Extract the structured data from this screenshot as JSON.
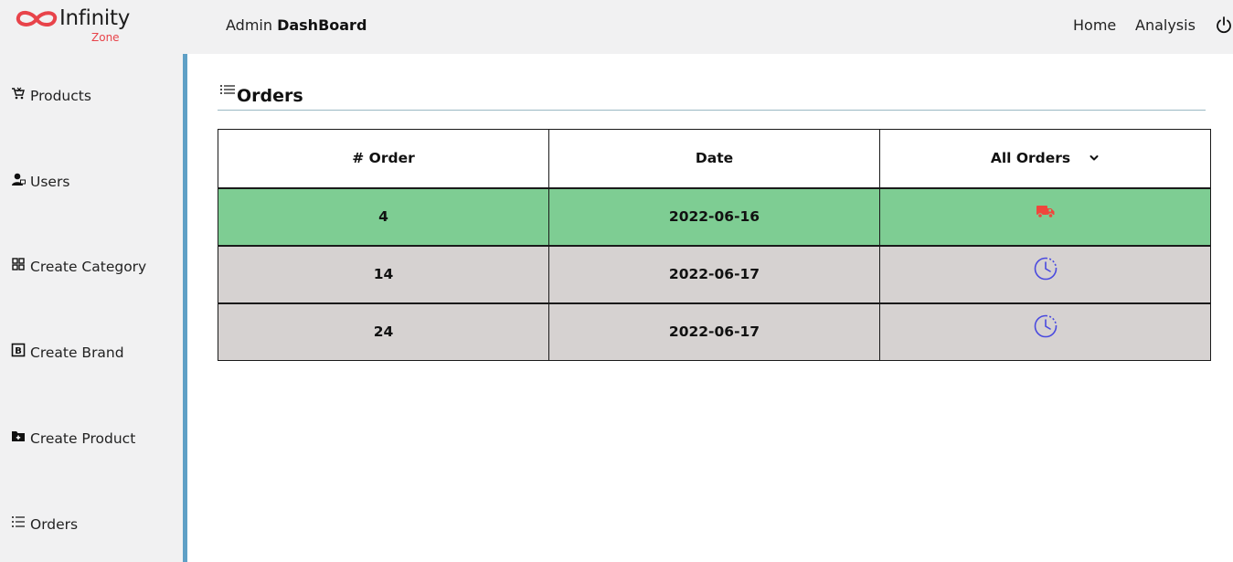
{
  "header": {
    "logo_text": "Infinity",
    "logo_sub": "Zone",
    "brand_prefix": "Admin ",
    "brand_strong": "DashBoard",
    "nav": [
      {
        "label": "Home"
      },
      {
        "label": "Analysis"
      }
    ],
    "power_icon": "power-icon"
  },
  "sidebar": {
    "items": [
      {
        "label": "Products",
        "icon": "cart-icon"
      },
      {
        "label": "Users",
        "icon": "user-icon"
      },
      {
        "label": "Create Category",
        "icon": "grid-icon"
      },
      {
        "label": "Create Brand",
        "icon": "brand-icon"
      },
      {
        "label": "Create Product",
        "icon": "folder-plus-icon"
      },
      {
        "label": "Orders",
        "icon": "list-icon"
      }
    ],
    "accent_color": "#5fa0c6"
  },
  "main": {
    "title": "Orders",
    "title_icon": "list-icon",
    "table": {
      "headers": [
        "# Order",
        "Date"
      ],
      "filter": {
        "selected": "All Orders"
      },
      "rows": [
        {
          "order": "4",
          "date": "2022-06-16",
          "status_icon": "truck-icon",
          "row_color": "#7ecd93"
        },
        {
          "order": "14",
          "date": "2022-06-17",
          "status_icon": "clock-icon",
          "row_color": "#d6d2d1"
        },
        {
          "order": "24",
          "date": "2022-06-17",
          "status_icon": "clock-icon",
          "row_color": "#d6d2d1"
        }
      ]
    }
  },
  "colors": {
    "logo_red": "#e8434a",
    "truck_red": "#f0463c",
    "clock_blue": "#4a4adf"
  }
}
